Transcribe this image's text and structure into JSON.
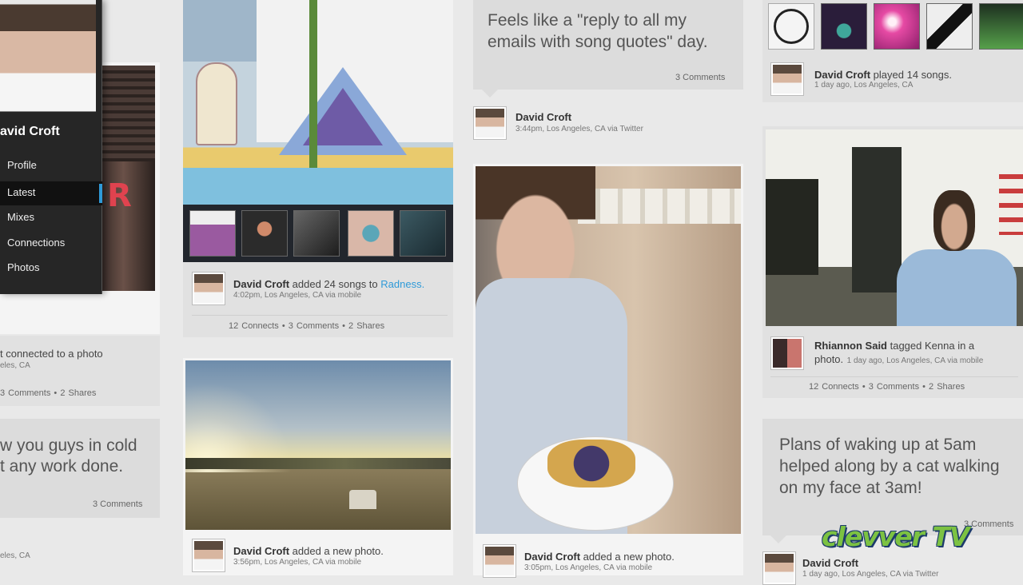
{
  "sidebar": {
    "user_name": "avid Croft",
    "items": [
      {
        "label": "Profile"
      },
      {
        "label": "Latest"
      },
      {
        "label": "Mixes"
      },
      {
        "label": "Connections"
      },
      {
        "label": "Photos"
      }
    ]
  },
  "col1": {
    "snippet_line1": "t connected to a photo",
    "snippet_line2": "eles, CA",
    "stats": "3 Comments  •  2 Shares",
    "quote_line1": "w you guys in cold",
    "quote_line2": "t any work done.",
    "comments": "3 Comments",
    "bottom_meta": "eles, CA"
  },
  "col2": {
    "post1": {
      "name": "David Croft",
      "action": " added 24 songs to ",
      "link": "Radness.",
      "meta": "4:02pm, Los Angeles, CA via mobile",
      "stats": "12 Connects  •  3 Comments  •  2 Shares"
    },
    "post2": {
      "name": "David Croft",
      "action": " added a new photo.",
      "meta": "3:56pm, Los Angeles, CA via mobile"
    }
  },
  "col3": {
    "quote": "Feels like a \"reply to all my emails with song quotes\" day.",
    "comments": "3 Comments",
    "post1": {
      "name": "David Croft",
      "meta": "3:44pm, Los Angeles, CA via Twitter"
    },
    "post2": {
      "name": "David Croft",
      "action": " added a new photo.",
      "meta": "3:05pm, Los Angeles, CA via mobile"
    }
  },
  "col4": {
    "post1": {
      "name": "David Croft",
      "action": " played 14 songs.",
      "meta": "1 day ago, Los Angeles, CA"
    },
    "post2": {
      "name": "Rhiannon Said",
      "action": " tagged Kenna in a photo.",
      "meta": "1 day ago, Los Angeles, CA via mobile",
      "stats": "12 Connects  •  3 Comments  •  2 Shares"
    },
    "quote": "Plans of waking up at 5am helped along by a cat walking on my face at 3am!",
    "comments": "3 Comments",
    "post3": {
      "name": "David Croft",
      "meta": "1 day ago, Los Angeles, CA via Twitter"
    }
  },
  "watermark": "clevver TV",
  "colors": {
    "link": "#2f9ad8",
    "sidebar_bg": "#262626",
    "card_bg": "#dcdcdc",
    "page_bg": "#e9e9e9",
    "watermark_primary": "#7cc242",
    "watermark_secondary": "#f2c430"
  }
}
